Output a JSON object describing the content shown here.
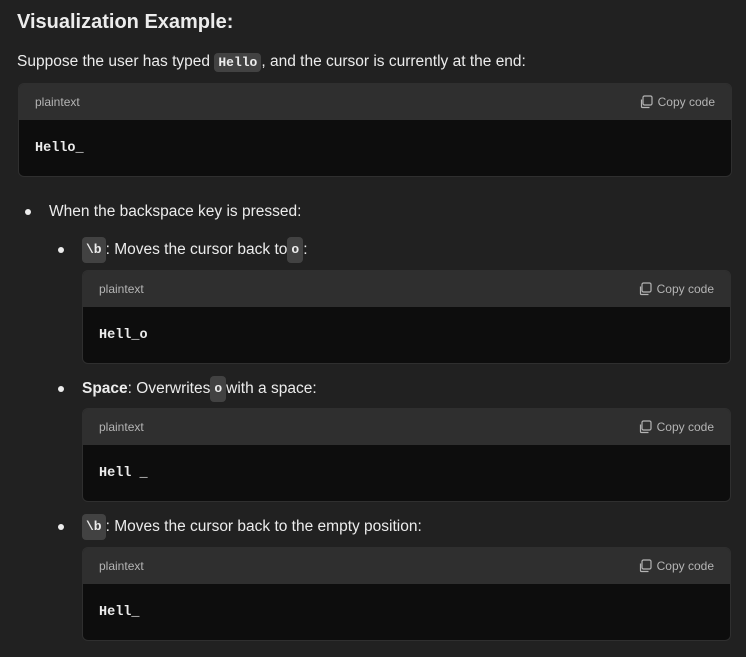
{
  "heading": "Visualization Example:",
  "intro": {
    "before": "Suppose the user has typed ",
    "code": "Hello",
    "after": ", and the cursor is currently at the end:"
  },
  "copy_label": "Copy code",
  "blocks": [
    {
      "lang": "plaintext",
      "code": "Hello_"
    },
    {
      "lang": "plaintext",
      "code": "Hell_o"
    },
    {
      "lang": "plaintext",
      "code": "Hell _"
    },
    {
      "lang": "plaintext",
      "code": "Hell_"
    }
  ],
  "bullet1": "When the backspace key is pressed:",
  "sub": [
    {
      "code1": "\\b",
      "text": ": Moves the cursor back to ",
      "code2": "o",
      "tail": ":"
    },
    {
      "bold": "Space",
      "text": ": Overwrites ",
      "code2": "o",
      "tail": " with a space:"
    },
    {
      "code1": "\\b",
      "text": ": Moves the cursor back to the empty position:"
    }
  ]
}
